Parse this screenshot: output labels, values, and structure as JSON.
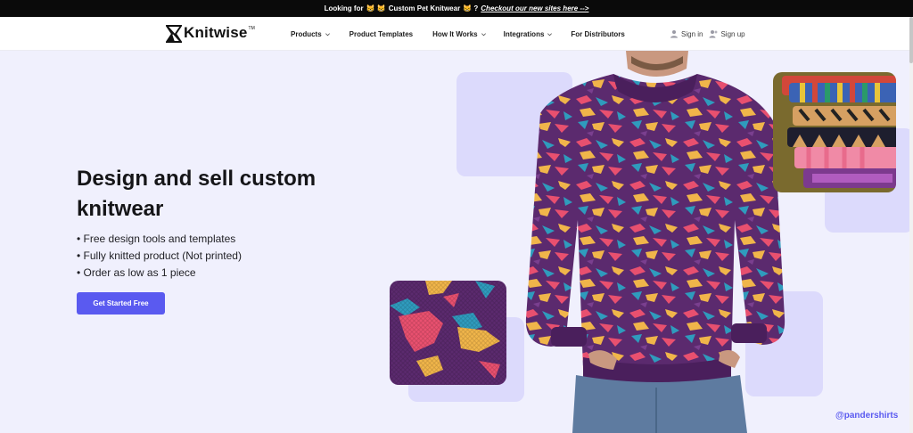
{
  "announcement": {
    "prefix": "Looking for",
    "emoji_left": "😸 😸",
    "middle": "Custom Pet Knitwear",
    "emoji_right": "😸 ?",
    "link": "Checkout our new sites here -->"
  },
  "header": {
    "logo_text": "Knitwise",
    "logo_tm": "TM",
    "nav": [
      {
        "label": "Products",
        "has_dropdown": true
      },
      {
        "label": "Product Templates",
        "has_dropdown": false
      },
      {
        "label": "How It Works",
        "has_dropdown": true
      },
      {
        "label": "Integrations",
        "has_dropdown": true
      },
      {
        "label": "For Distributors",
        "has_dropdown": false
      }
    ],
    "sign_in": "Sign in",
    "sign_up": "Sign up"
  },
  "hero": {
    "headline": "Design and sell custom knitwear",
    "bullets": [
      "• Free design tools and templates",
      "• Fully knitted product (Not printed)",
      "• Order as low as 1 piece"
    ],
    "cta_label": "Get Started Free",
    "social_handle": "@pandershirts"
  },
  "colors": {
    "accent": "#5a5af0",
    "hero_bg": "#f0f0fd",
    "deco": "#dcdafc",
    "sweater": "#5b2a6e"
  }
}
